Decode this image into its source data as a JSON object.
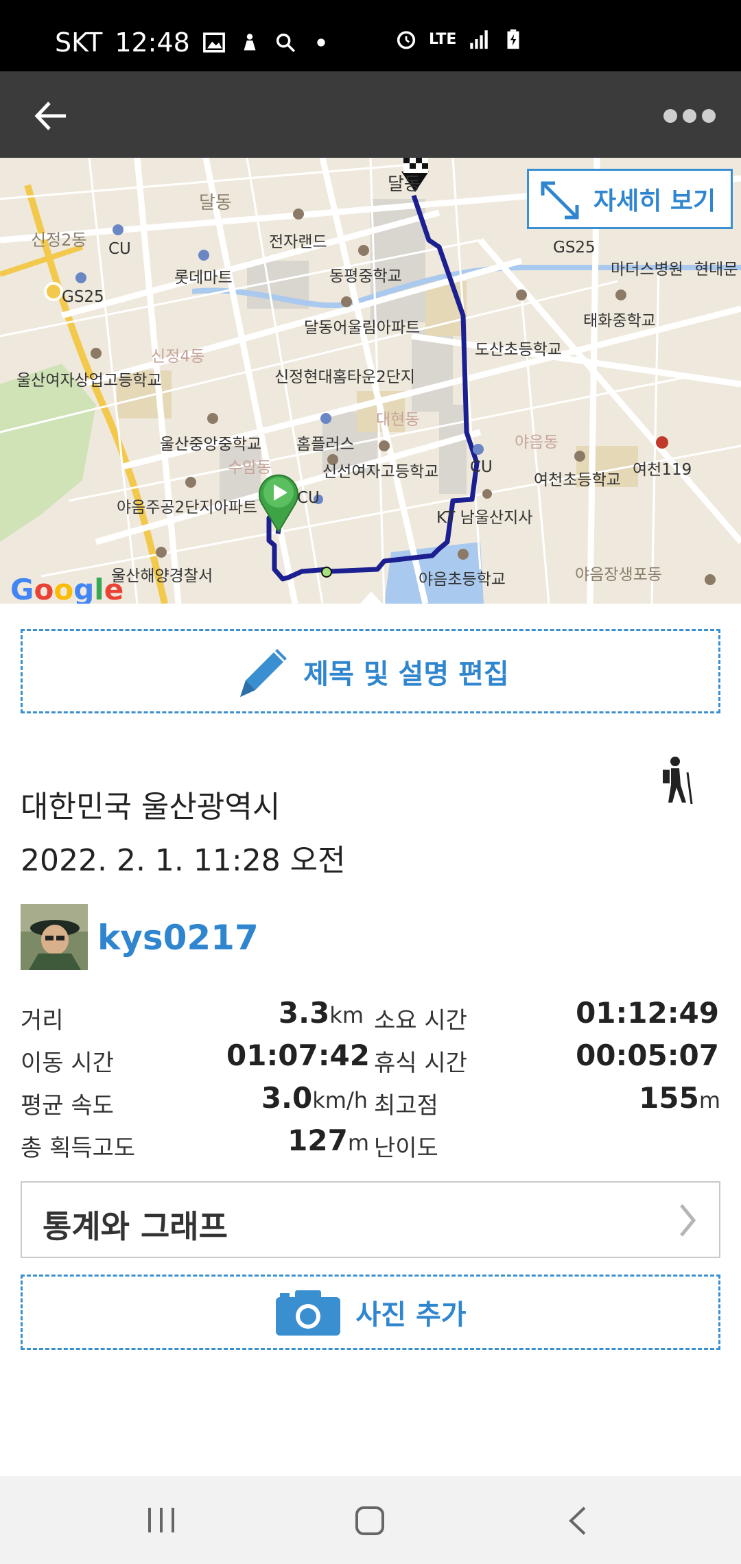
{
  "status_bar": {
    "carrier": "SKT",
    "time": "12:48",
    "network": "LTE"
  },
  "map": {
    "detail_button_label": "자세히 보기",
    "google_logo": "Google",
    "labels": [
      "달동",
      "달동",
      "신정2동",
      "CU",
      "전자랜드",
      "GS25",
      "마더스병원",
      "현대문",
      "롯데마트",
      "동평중학교",
      "GS25",
      "태화중학교",
      "달동어울림아파트",
      "도산초등학교",
      "신정4동",
      "울산여자상업고등학교",
      "신정현대홈타운2단지",
      "대현동",
      "야음동",
      "울산중앙중학교",
      "홈플러스",
      "여천119",
      "수암동",
      "신선여자고등학교",
      "CU",
      "여천초등학교",
      "야음주공2단지아파트",
      "CU",
      "KT 남울산지사",
      "울산해양경찰서",
      "야음초등학교",
      "야음장생포동"
    ]
  },
  "edit_button_label": "제목 및 설명 편집",
  "location": "대한민국 울산광역시",
  "datetime": "2022. 2. 1. 11:28 오전",
  "activity_icon": "hiker-icon",
  "username": "kys0217",
  "stats": {
    "distance_label": "거리",
    "distance_value": "3.3",
    "distance_unit": "km",
    "duration_label": "소요 시간",
    "duration_value": "01:12:49",
    "moving_label": "이동 시간",
    "moving_value": "01:07:42",
    "rest_label": "휴식 시간",
    "rest_value": "00:05:07",
    "speed_label": "평균 속도",
    "speed_value": "3.0",
    "speed_unit": "km/h",
    "max_label": "최고점",
    "max_value": "155",
    "max_unit": "m",
    "gain_label": "총 획득고도",
    "gain_value": "127",
    "gain_unit": "m",
    "difficulty_label": "난이도"
  },
  "stats_button_label": "통계와 그래프",
  "add_photo_label": "사진 추가",
  "colors": {
    "accent": "#2f86cf",
    "route": "#1b1f8f",
    "toolbar": "#3b3b3b"
  }
}
